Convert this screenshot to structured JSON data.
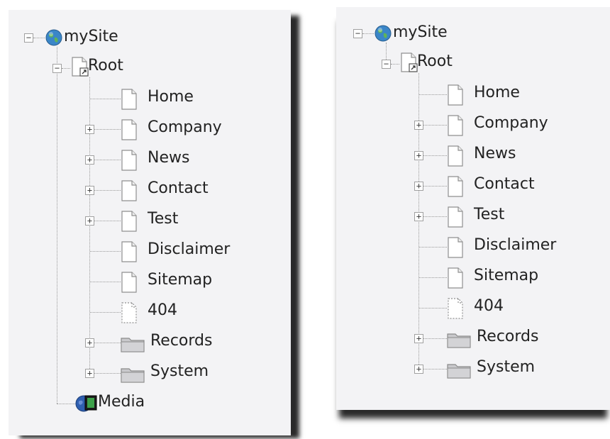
{
  "colors": {
    "panel_bg": "#f3f3f5",
    "text": "#222222",
    "connector": "#9a9a9a",
    "shadow": "#2a2a2a"
  },
  "trees": [
    {
      "id": "left",
      "site_label": "mySite",
      "root_label": "Root",
      "pages": [
        {
          "label": "Home",
          "icon": "page-icon",
          "expandable": false
        },
        {
          "label": "Company",
          "icon": "page-icon",
          "expandable": true
        },
        {
          "label": "News",
          "icon": "page-icon",
          "expandable": true
        },
        {
          "label": "Contact",
          "icon": "page-icon",
          "expandable": true
        },
        {
          "label": "Test",
          "icon": "page-icon",
          "expandable": true
        },
        {
          "label": "Disclaimer",
          "icon": "page-icon",
          "expandable": false
        },
        {
          "label": "Sitemap",
          "icon": "page-icon",
          "expandable": false
        },
        {
          "label": "404",
          "icon": "hidden-page-icon",
          "expandable": false
        },
        {
          "label": "Records",
          "icon": "folder-icon",
          "expandable": true
        },
        {
          "label": "System",
          "icon": "folder-icon",
          "expandable": true
        }
      ],
      "media_label": "Media"
    },
    {
      "id": "right",
      "site_label": "mySite",
      "root_label": "Root",
      "pages": [
        {
          "label": "Home",
          "icon": "page-icon",
          "expandable": false
        },
        {
          "label": "Company",
          "icon": "page-icon",
          "expandable": true
        },
        {
          "label": "News",
          "icon": "page-icon",
          "expandable": true
        },
        {
          "label": "Contact",
          "icon": "page-icon",
          "expandable": true
        },
        {
          "label": "Test",
          "icon": "page-icon",
          "expandable": true
        },
        {
          "label": "Disclaimer",
          "icon": "page-icon",
          "expandable": false
        },
        {
          "label": "Sitemap",
          "icon": "page-icon",
          "expandable": false
        },
        {
          "label": "404",
          "icon": "hidden-page-icon",
          "expandable": false
        },
        {
          "label": "Records",
          "icon": "folder-icon",
          "expandable": true
        },
        {
          "label": "System",
          "icon": "folder-icon",
          "expandable": true
        }
      ]
    }
  ]
}
